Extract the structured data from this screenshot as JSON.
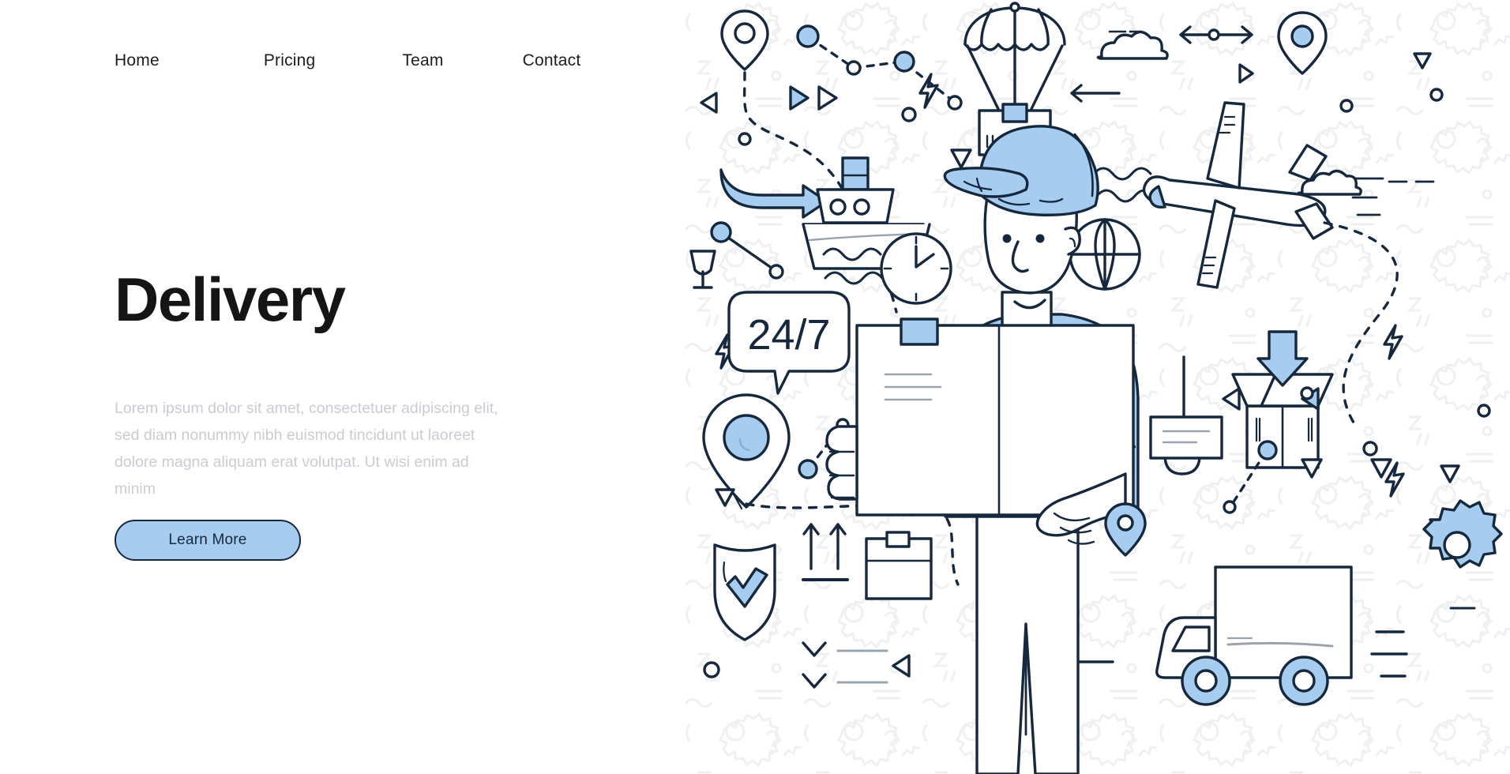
{
  "nav": {
    "items": [
      {
        "label": "Home"
      },
      {
        "label": "Pricing"
      },
      {
        "label": "Team"
      },
      {
        "label": "Contact"
      }
    ]
  },
  "hero": {
    "title": "Delivery",
    "paragraph": "Lorem ipsum dolor sit amet, consectetuer adipiscing elit, sed diam nonummy nibh euismod tincidunt ut laoreet dolore magna aliquam erat volutpat. Ut wisi enim ad minim",
    "cta_label": "Learn More"
  },
  "illustration": {
    "speech_bubble_text": "24/7",
    "elements": [
      "location-pin-outline-icon",
      "parachute-package-icon",
      "cloud-icon",
      "double-arrow-icon",
      "location-pin-filled-icon",
      "cargo-ship-icon",
      "airplane-icon",
      "globe-icon",
      "clock-icon",
      "speech-bubble-24-7",
      "delivery-man-character",
      "package-box-icon",
      "open-box-icon",
      "down-arrow-icon",
      "crane-hook-icon",
      "shield-check-icon",
      "this-way-up-arrows-icon",
      "small-package-icon",
      "delivery-truck-icon",
      "gear-icon",
      "play-triangle-icon",
      "dashed-route-line",
      "wine-glass-fragile-icon",
      "lightning-bolt-icon",
      "wave-line-icon"
    ]
  },
  "colors": {
    "accent_blue": "#a6cdef",
    "outline_navy": "#16283d",
    "text_dark": "#151515",
    "text_muted": "#c9ccd1",
    "pattern_gray": "#eff0f1",
    "background": "#ffffff"
  }
}
